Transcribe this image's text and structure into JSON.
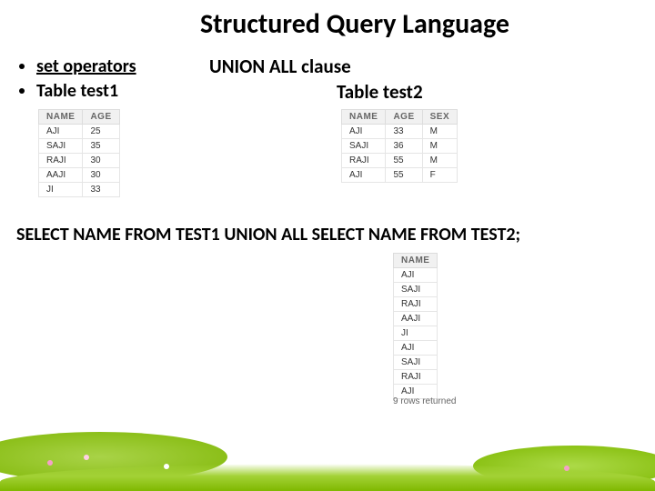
{
  "title": "Structured Query Language",
  "bullets": {
    "items": [
      {
        "label": "set operators",
        "underline": true
      },
      {
        "label": "Table test1",
        "underline": false
      }
    ]
  },
  "clause": "UNION ALL clause",
  "table2_label": "Table test2",
  "test1": {
    "headers": {
      "c0": "NAME",
      "c1": "AGE"
    },
    "rows": [
      {
        "c0": "AJI",
        "c1": "25"
      },
      {
        "c0": "SAJI",
        "c1": "35"
      },
      {
        "c0": "RAJI",
        "c1": "30"
      },
      {
        "c0": "AAJI",
        "c1": "30"
      },
      {
        "c0": "JI",
        "c1": "33"
      }
    ]
  },
  "test2": {
    "headers": {
      "c0": "NAME",
      "c1": "AGE",
      "c2": "SEX"
    },
    "rows": [
      {
        "c0": "AJI",
        "c1": "33",
        "c2": "M"
      },
      {
        "c0": "SAJI",
        "c1": "36",
        "c2": "M"
      },
      {
        "c0": "RAJI",
        "c1": "55",
        "c2": "M"
      },
      {
        "c0": "AJI",
        "c1": "55",
        "c2": "F"
      }
    ]
  },
  "sql": "SELECT NAME FROM TEST1 UNION ALL SELECT NAME FROM TEST2;",
  "result": {
    "headers": {
      "c0": "NAME"
    },
    "rows": [
      {
        "c0": "AJI"
      },
      {
        "c0": "SAJI"
      },
      {
        "c0": "RAJI"
      },
      {
        "c0": "AAJI"
      },
      {
        "c0": "JI"
      },
      {
        "c0": "AJI"
      },
      {
        "c0": "SAJI"
      },
      {
        "c0": "RAJI"
      },
      {
        "c0": "AJI"
      }
    ],
    "returned": "9 rows returned"
  }
}
